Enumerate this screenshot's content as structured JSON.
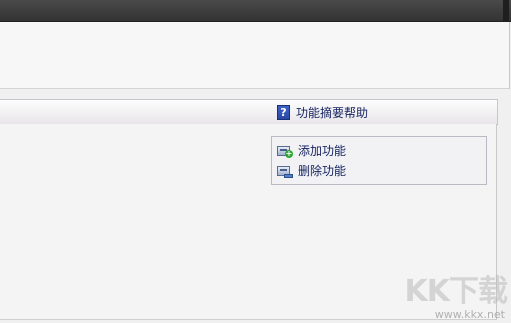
{
  "section": {
    "help_label": "功能摘要帮助"
  },
  "actions": {
    "add_label": "添加功能",
    "remove_label": "删除功能"
  },
  "watermark": {
    "logo": "KK下载",
    "url": "www.kkx.net"
  },
  "colors": {
    "link_text": "#14215e",
    "titlebar": "#3a3a3a",
    "add_icon_accent": "#2fa634"
  }
}
